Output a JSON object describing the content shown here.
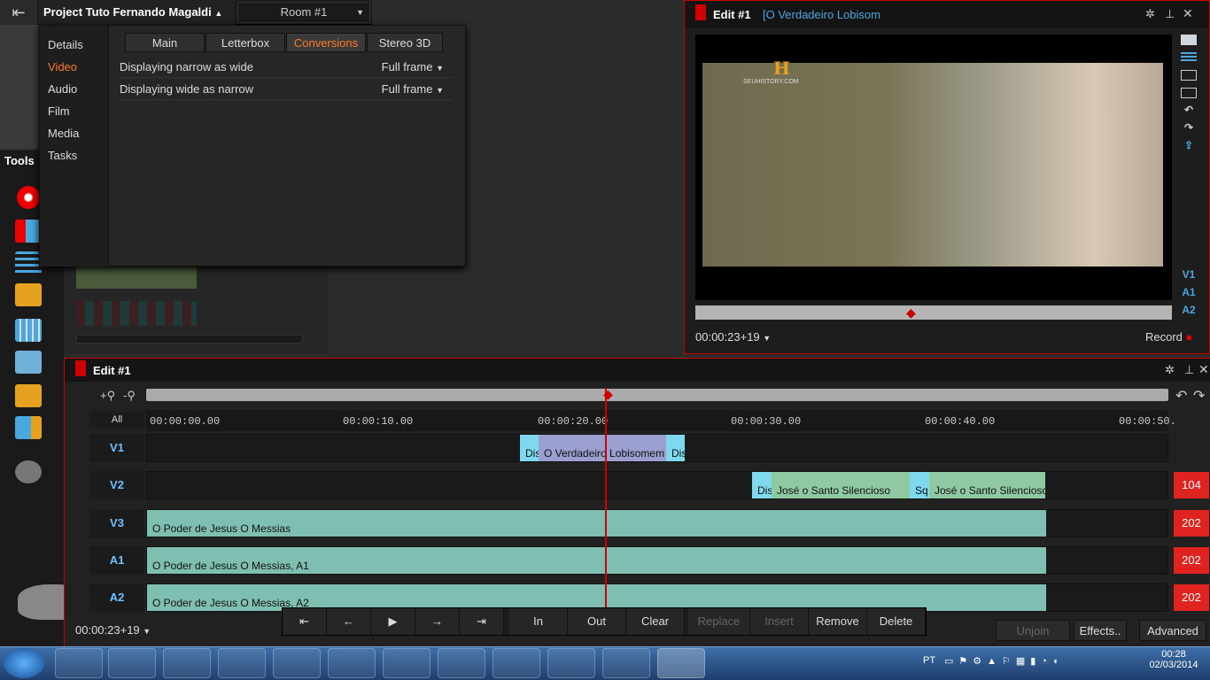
{
  "app": {
    "project_name": "Project Tuto Fernando Magaldi",
    "room": "Room #1",
    "tools_label": "Tools"
  },
  "popup": {
    "nav": [
      "Details",
      "Video",
      "Audio",
      "Film",
      "Media",
      "Tasks"
    ],
    "nav_active": "Video",
    "tabs": [
      "Main",
      "Letterbox",
      "Conversions",
      "Stereo 3D"
    ],
    "tab_active": "Conversions",
    "rows": [
      {
        "label": "Displaying narrow as wide",
        "value": "Full frame"
      },
      {
        "label": "Displaying wide as narrow",
        "value": "Full frame"
      }
    ]
  },
  "viewer": {
    "title": "Edit #1",
    "subtitle": "[O Verdadeiro Lobisom",
    "watermark": "SEUHISTORY.COM",
    "timecode": "00:00:23+19",
    "record_label": "Record",
    "track_buttons": [
      "V1",
      "A1",
      "A2"
    ]
  },
  "timeline": {
    "title": "Edit #1",
    "all_label": "All",
    "ticks": [
      "00:00:00.00",
      "00:00:10.00",
      "00:00:20.00",
      "00:00:30.00",
      "00:00:40.00",
      "00:00:50."
    ],
    "tracks": [
      {
        "name": "V1",
        "counter": ""
      },
      {
        "name": "V2",
        "counter": "104"
      },
      {
        "name": "V3",
        "counter": "202"
      },
      {
        "name": "A1",
        "counter": "202"
      },
      {
        "name": "A2",
        "counter": "202"
      }
    ],
    "clips": {
      "v1_a": "Dis",
      "v1_b": "O Verdadeiro Lobisomem",
      "v1_c": "Dis",
      "v2_a": "Dis",
      "v2_b": "José o Santo Silencioso",
      "v2_c": "Sq",
      "v2_d": "José o Santo Silencioso",
      "v3": "O Poder de Jesus   O Messias",
      "a1": "O Poder de Jesus   O Messias, A1",
      "a2": "O Poder de Jesus   O Messias, A2"
    },
    "timecode": "00:00:23+19"
  },
  "transport": {
    "in": "In",
    "out": "Out",
    "clear": "Clear",
    "replace": "Replace",
    "insert": "Insert",
    "remove": "Remove",
    "delete": "Delete"
  },
  "right_buttons": {
    "unjoin": "Unjoin",
    "effects": "Effects..",
    "advanced": "Advanced"
  },
  "taskbar": {
    "lang": "PT",
    "time": "00:28",
    "date": "02/03/2014"
  },
  "colors": {
    "accent_red": "#e0231e",
    "accent_blue": "#4aa8e0",
    "clip_teal": "#7fbfb2",
    "clip_lilac": "#9a9fd0",
    "clip_cyan": "#7fd9ee",
    "active_orange": "#ff7a2a"
  }
}
